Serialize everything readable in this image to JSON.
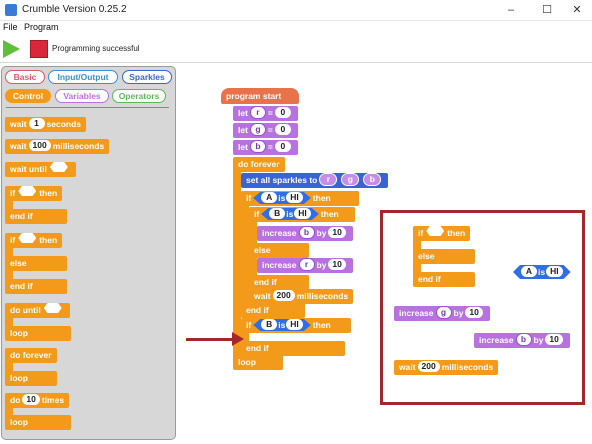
{
  "window": {
    "title": "Crumble Version 0.25.2",
    "min": "–",
    "max": "☐",
    "close": "✕"
  },
  "menu": {
    "file": "File",
    "program": "Program"
  },
  "toolbar": {
    "status": "Programming successful"
  },
  "palette": {
    "categories": [
      {
        "label": "Basic",
        "color": "#e2566a"
      },
      {
        "label": "Input/Output",
        "color": "#3a8fd8"
      },
      {
        "label": "Sparkles",
        "color": "#3a63d6"
      },
      {
        "label": "Control",
        "color": "#f49a1a"
      },
      {
        "label": "Variables",
        "color": "#b772e0"
      },
      {
        "label": "Operators",
        "color": "#5cb85c"
      }
    ],
    "blocks": {
      "wait_seconds": {
        "a": "wait",
        "v": "1",
        "b": "seconds"
      },
      "wait_ms": {
        "a": "wait",
        "v": "100",
        "b": "milliseconds"
      },
      "wait_until": "wait until",
      "if1": {
        "if": "if",
        "then": "then",
        "end": "end if"
      },
      "if2": {
        "if": "if",
        "then": "then",
        "else": "else",
        "end": "end if"
      },
      "do_until": {
        "a": "do until",
        "loop": "loop"
      },
      "do_forever": {
        "a": "do forever",
        "loop": "loop"
      },
      "do_times": {
        "a": "do",
        "v": "10",
        "b": "times",
        "loop": "loop"
      }
    }
  },
  "program": {
    "start": "program start",
    "let_r": {
      "k": "let",
      "var": "r",
      "eq": "=",
      "v": "0"
    },
    "let_g": {
      "k": "let",
      "var": "g",
      "eq": "=",
      "v": "0"
    },
    "let_b": {
      "k": "let",
      "var": "b",
      "eq": "=",
      "v": "0"
    },
    "do_forever": "do forever",
    "set_sparkles": {
      "a": "set all sparkles to",
      "r": "r",
      "g": "g",
      "b": "b"
    },
    "if_a": {
      "if": "if",
      "in": "A",
      "is": "is",
      "st": "HI",
      "then": "then"
    },
    "if_b": {
      "if": "if",
      "in": "B",
      "is": "is",
      "st": "HI",
      "then": "then"
    },
    "inc_b": {
      "a": "increase",
      "var": "b",
      "by": "by",
      "v": "10"
    },
    "else": "else",
    "inc_r": {
      "a": "increase",
      "var": "r",
      "by": "by",
      "v": "10"
    },
    "end_if_inner": "end if",
    "wait_ms": {
      "a": "wait",
      "v": "200",
      "b": "milliseconds"
    },
    "end_if_outer": "end if",
    "if_b2": {
      "if": "if",
      "in": "B",
      "is": "is",
      "st": "HI",
      "then": "then"
    },
    "end_if_b2": "end if",
    "loop": "loop"
  },
  "loose": {
    "if": {
      "if": "if",
      "then": "then",
      "else": "else",
      "end": "end if"
    },
    "cond": {
      "in": "A",
      "is": "is",
      "st": "HI"
    },
    "inc_g": {
      "a": "increase",
      "var": "g",
      "by": "by",
      "v": "10"
    },
    "inc_b": {
      "a": "increase",
      "var": "b",
      "by": "by",
      "v": "10"
    },
    "wait": {
      "a": "wait",
      "v": "200",
      "b": "milliseconds"
    }
  }
}
